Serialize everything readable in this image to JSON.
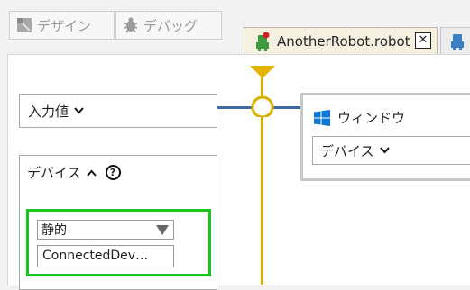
{
  "toolbar": {
    "design_label": "デザイン",
    "debug_label": "デバッグ"
  },
  "tabs": [
    {
      "label": "AnotherRobot.robot",
      "close_glyph": "✕"
    }
  ],
  "nodes": {
    "input": {
      "label": "入力値"
    },
    "device": {
      "label": "デバイス",
      "help_glyph": "?",
      "mode_selected": "静的",
      "value": "ConnectedDev…"
    },
    "window": {
      "title": "ウィンドウ",
      "device_select": "デバイス"
    }
  },
  "colors": {
    "flow_wire": "#3e6aa3",
    "control_wire": "#d8b000",
    "highlight": "#1ec51e",
    "windows_blue": "#0a78d7"
  }
}
